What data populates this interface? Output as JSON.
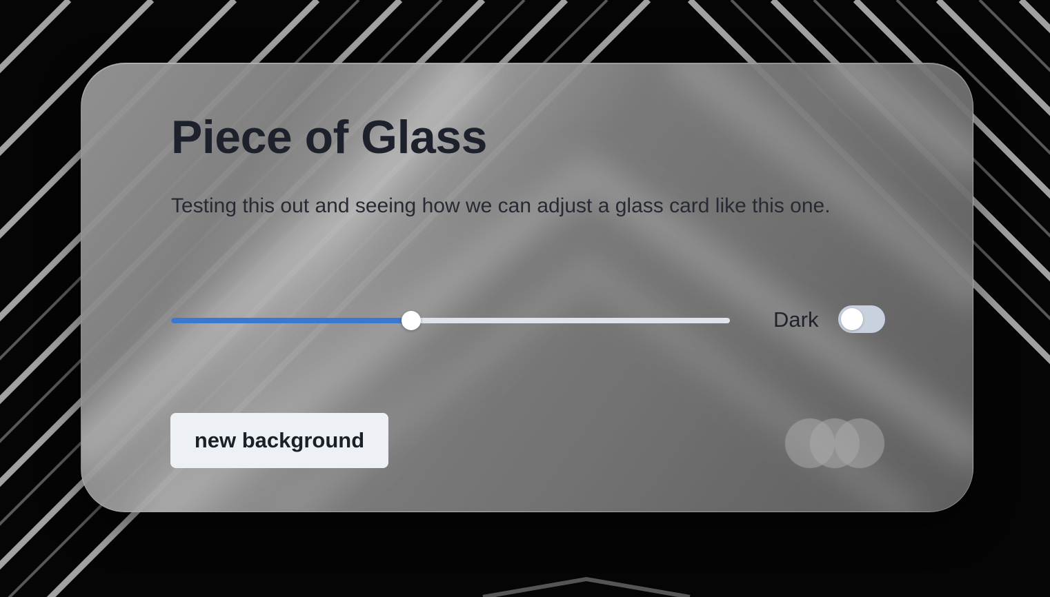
{
  "card": {
    "title": "Piece of Glass",
    "subtitle": "Testing this out and seeing how we can adjust a glass card like this one."
  },
  "slider": {
    "value_fraction": 0.43,
    "fill_color": "#3b78d0",
    "track_color": "#dfe4ec"
  },
  "toggle": {
    "label": "Dark",
    "checked": false
  },
  "button": {
    "label": "new background"
  },
  "dots": {
    "count": 3
  }
}
